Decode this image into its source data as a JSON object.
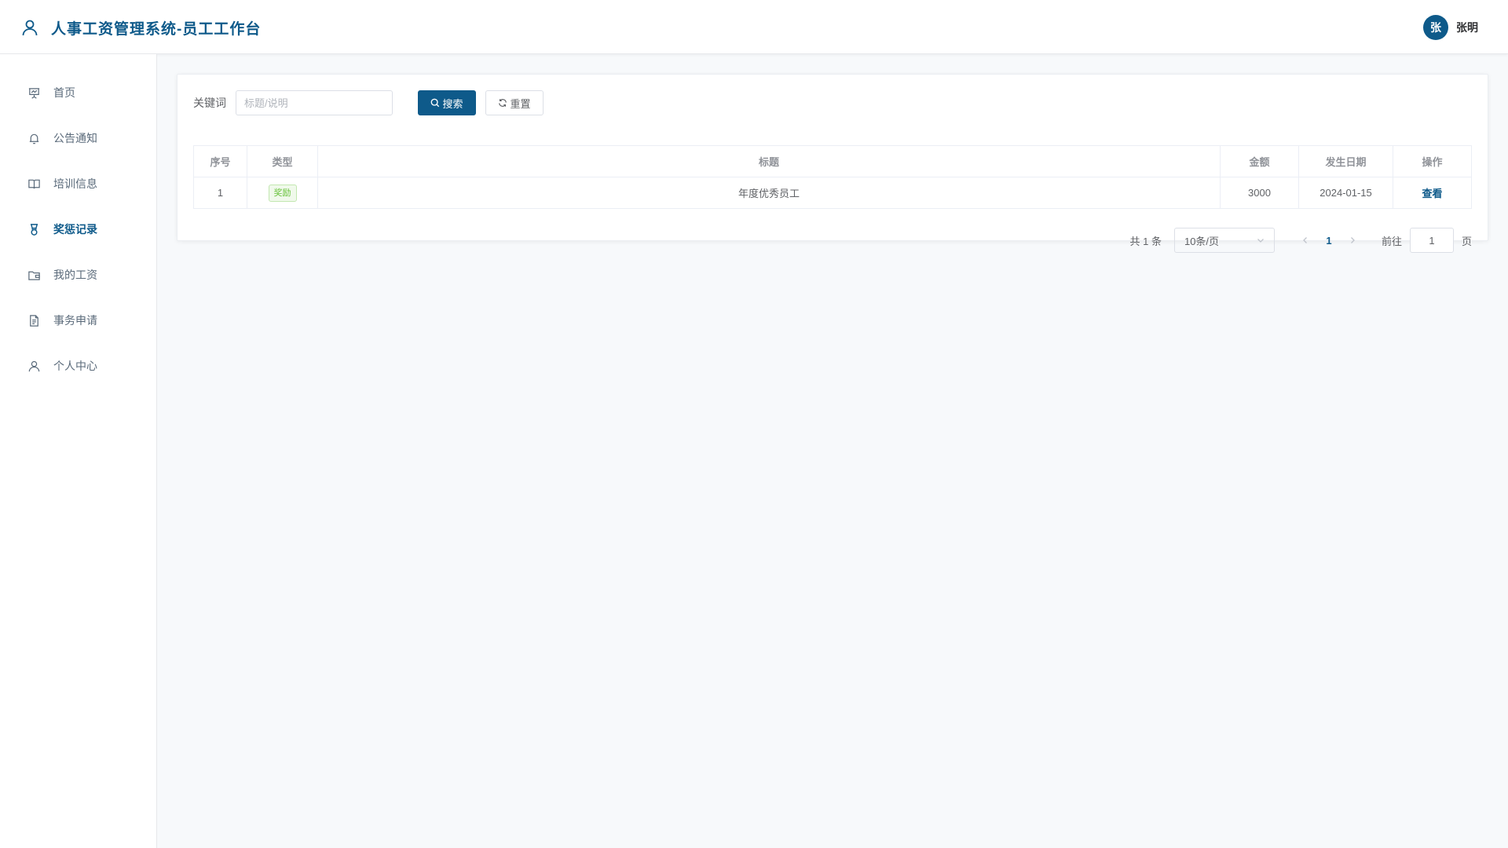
{
  "header": {
    "title": "人事工资管理系统-员工工作台",
    "avatar_text": "张",
    "username": "张明",
    "brand_color": "#0e5a8a"
  },
  "sidebar": {
    "items": [
      {
        "label": "首页",
        "icon": "presentation-icon",
        "active": false
      },
      {
        "label": "公告通知",
        "icon": "bell-icon",
        "active": false
      },
      {
        "label": "培训信息",
        "icon": "book-icon",
        "active": false
      },
      {
        "label": "奖惩记录",
        "icon": "medal-icon",
        "active": true
      },
      {
        "label": "我的工资",
        "icon": "wallet-icon",
        "active": false
      },
      {
        "label": "事务申请",
        "icon": "document-icon",
        "active": false
      },
      {
        "label": "个人中心",
        "icon": "user-icon",
        "active": false
      }
    ]
  },
  "filter": {
    "label": "关键词",
    "placeholder": "标题/说明",
    "value": "",
    "search_label": "搜索",
    "reset_label": "重置"
  },
  "table": {
    "columns": [
      "序号",
      "类型",
      "标题",
      "金额",
      "发生日期",
      "操作"
    ],
    "rows": [
      {
        "index": "1",
        "type": "奖励",
        "title": "年度优秀员工",
        "amount": "3000",
        "date": "2024-01-15",
        "action": "查看"
      }
    ]
  },
  "pagination": {
    "total_text": "共 1 条",
    "page_size": "10条/页",
    "current_page": "1",
    "goto_label": "前往",
    "goto_value": "1",
    "goto_suffix": "页"
  }
}
